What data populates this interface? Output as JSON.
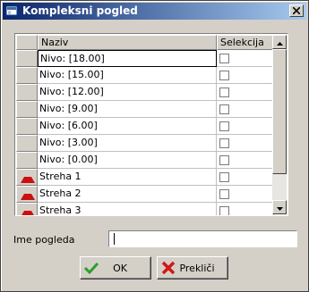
{
  "window": {
    "title": "Kompleksni pogled",
    "title_icon": "view-icon",
    "close_icon": "close-icon"
  },
  "table": {
    "columns": [
      "",
      "Naziv",
      "Selekcija"
    ],
    "rows": [
      {
        "name": "Nivo: [18.00]",
        "icon": "",
        "selected": true,
        "checked": false
      },
      {
        "name": "Nivo: [15.00]",
        "icon": "",
        "selected": false,
        "checked": false
      },
      {
        "name": "Nivo: [12.00]",
        "icon": "",
        "selected": false,
        "checked": false
      },
      {
        "name": "Nivo: [9.00]",
        "icon": "",
        "selected": false,
        "checked": false
      },
      {
        "name": "Nivo: [6.00]",
        "icon": "",
        "selected": false,
        "checked": false
      },
      {
        "name": "Nivo: [3.00]",
        "icon": "",
        "selected": false,
        "checked": false
      },
      {
        "name": "Nivo: [0.00]",
        "icon": "",
        "selected": false,
        "checked": false
      },
      {
        "name": "Streha 1",
        "icon": "roof-icon",
        "selected": false,
        "checked": false
      },
      {
        "name": "Streha 2",
        "icon": "roof-icon",
        "selected": false,
        "checked": false
      },
      {
        "name": "Streha 3",
        "icon": "roof-icon",
        "selected": false,
        "checked": false
      }
    ]
  },
  "form": {
    "view_name_label": "Ime pogleda",
    "view_name_value": ""
  },
  "buttons": {
    "ok_label": "OK",
    "ok_icon": "checkmark-icon",
    "cancel_label": "Prekliči",
    "cancel_icon": "red-x-icon"
  },
  "colors": {
    "title_gradient_start": "#0a246a",
    "title_gradient_end": "#a6caf0",
    "roof_icon": "#cc1010",
    "ok_icon": "#2aa02a",
    "cancel_icon": "#d01818"
  }
}
